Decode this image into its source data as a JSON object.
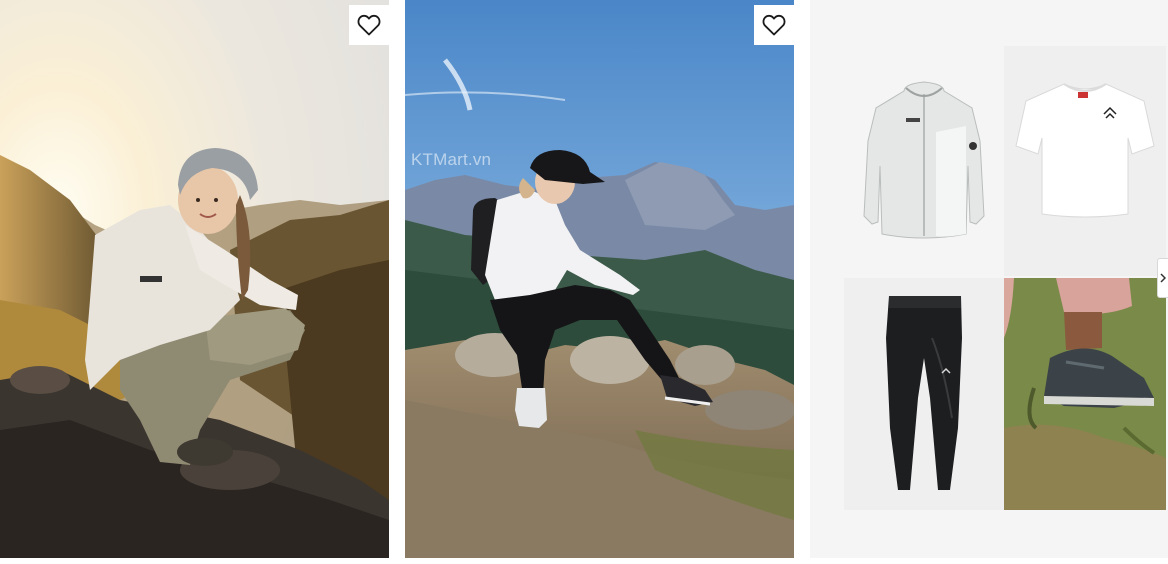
{
  "watermark": {
    "text": "KTMart.vn"
  },
  "colors": {
    "panel_bg": "#f5f5f5",
    "tile_bg": "#efefef",
    "icon_stroke": "#1a1a1a"
  },
  "cards": [
    {
      "name": "hiking-photo-woman-seated",
      "favorite_icon": "heart-outline-icon",
      "favorited": false
    },
    {
      "name": "hiking-photo-woman-on-rocks",
      "favorite_icon": "heart-outline-icon",
      "favorited": false
    }
  ],
  "outfit_items": [
    {
      "name": "fleece-jacket",
      "icon": "jacket-image"
    },
    {
      "name": "t-shirt",
      "icon": "tshirt-image"
    },
    {
      "name": "leggings",
      "icon": "leggings-image"
    },
    {
      "name": "hiking-shoes",
      "icon": "shoes-image"
    }
  ],
  "carousel": {
    "next_icon": "chevron-right-icon"
  }
}
